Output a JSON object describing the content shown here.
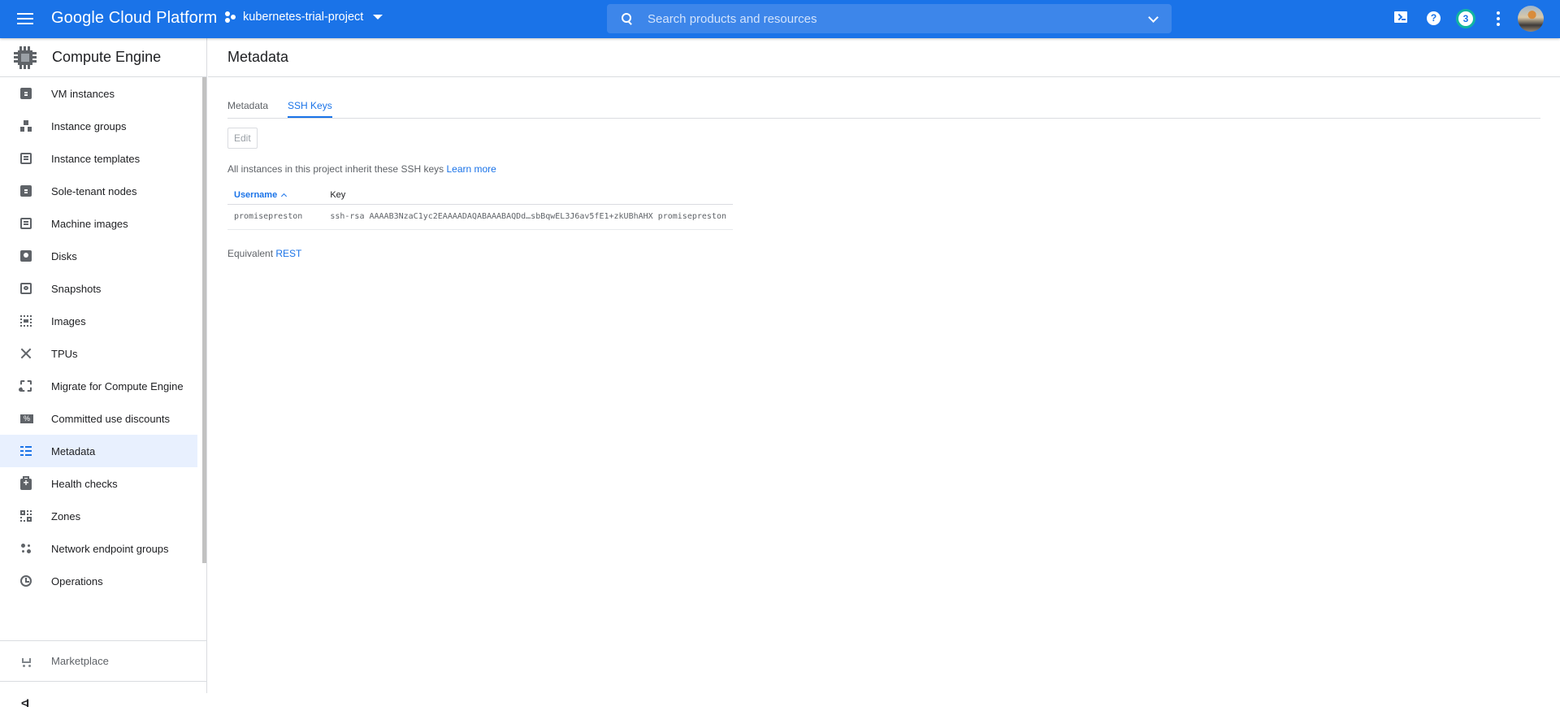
{
  "topbar": {
    "brand": "Google Cloud Platform",
    "project": "kubernetes-trial-project",
    "search_placeholder": "Search products and resources",
    "notifications_count": "3",
    "help_glyph": "?",
    "colors": {
      "bar": "#1a73e8",
      "notif_ring": "#12b5a0"
    }
  },
  "sidebar": {
    "title": "Compute Engine",
    "items": [
      {
        "label": "VM instances",
        "icon": "vm-instances-icon"
      },
      {
        "label": "Instance groups",
        "icon": "instance-groups-icon"
      },
      {
        "label": "Instance templates",
        "icon": "instance-templates-icon"
      },
      {
        "label": "Sole-tenant nodes",
        "icon": "sole-tenant-nodes-icon"
      },
      {
        "label": "Machine images",
        "icon": "machine-images-icon"
      },
      {
        "label": "Disks",
        "icon": "disks-icon"
      },
      {
        "label": "Snapshots",
        "icon": "snapshots-icon"
      },
      {
        "label": "Images",
        "icon": "images-icon"
      },
      {
        "label": "TPUs",
        "icon": "tpus-icon"
      },
      {
        "label": "Migrate for Compute Engine",
        "icon": "migrate-icon"
      },
      {
        "label": "Committed use discounts",
        "icon": "percent-icon"
      },
      {
        "label": "Metadata",
        "icon": "metadata-icon",
        "active": true
      },
      {
        "label": "Health checks",
        "icon": "health-checks-icon"
      },
      {
        "label": "Zones",
        "icon": "zones-icon"
      },
      {
        "label": "Network endpoint groups",
        "icon": "network-endpoint-groups-icon"
      },
      {
        "label": "Operations",
        "icon": "clock-icon"
      }
    ],
    "percent_glyph": "%",
    "marketplace": "Marketplace",
    "collapse_glyph": "<I"
  },
  "main": {
    "title": "Metadata",
    "tabs": [
      {
        "label": "Metadata",
        "active": false
      },
      {
        "label": "SSH Keys",
        "active": true
      }
    ],
    "edit_label": "Edit",
    "info_text": "All instances in this project inherit these SSH keys ",
    "learn_more": "Learn more",
    "table": {
      "columns": [
        "Username",
        "Key"
      ],
      "sorted_column": "Username",
      "sort_direction": "ascending",
      "rows": [
        {
          "username": "promisepreston",
          "key": "ssh-rsa AAAAB3NzaC1yc2EAAAADAQABAAABAQDd…sbBqwEL3J6av5fE1+zkUBhAHX promisepreston"
        }
      ]
    },
    "equivalent_label": "Equivalent ",
    "rest_link": "REST"
  }
}
